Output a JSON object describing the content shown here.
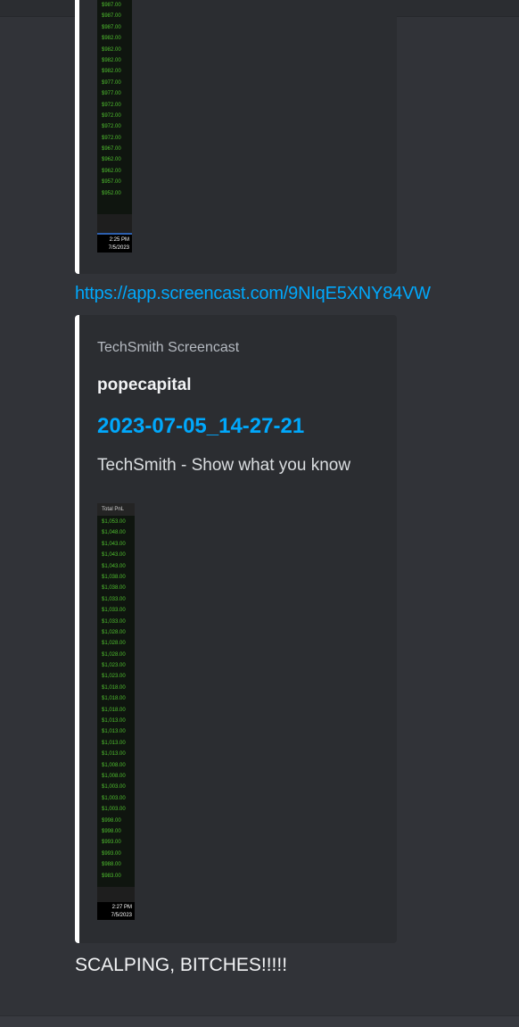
{
  "embed1": {
    "values": [
      "$987.00",
      "$987.00",
      "$987.00",
      "$982.00",
      "$982.00",
      "$982.00",
      "$982.00",
      "$977.00",
      "$977.00",
      "$972.00",
      "$972.00",
      "$972.00",
      "$972.00",
      "$967.00",
      "$962.00",
      "$962.00",
      "$957.00",
      "$952.00"
    ],
    "time": "2:25 PM",
    "date": "7/5/2023"
  },
  "link": "https://app.screencast.com/9NIqE5XNY84VW",
  "embed2": {
    "provider": "TechSmith Screencast",
    "author": "popecapital",
    "title": "2023-07-05_14-27-21",
    "description": "TechSmith - Show what you know",
    "header": "Total PnL",
    "values": [
      "$1,053.00",
      "$1,048.00",
      "$1,043.00",
      "$1,043.00",
      "$1,043.00",
      "$1,038.00",
      "$1,038.00",
      "$1,033.00",
      "$1,033.00",
      "$1,033.00",
      "$1,028.00",
      "$1,028.00",
      "$1,028.00",
      "$1,023.00",
      "$1,023.00",
      "$1,018.00",
      "$1,018.00",
      "$1,018.00",
      "$1,013.00",
      "$1,013.00",
      "$1,013.00",
      "$1,013.00",
      "$1,008.00",
      "$1,008.00",
      "$1,003.00",
      "$1,003.00",
      "$1,003.00",
      "$998.00",
      "$998.00",
      "$993.00",
      "$993.00",
      "$988.00",
      "$983.00"
    ],
    "time": "2:27 PM",
    "date": "7/5/2023"
  },
  "message": "SCALPING, BITCHES!!!!!"
}
